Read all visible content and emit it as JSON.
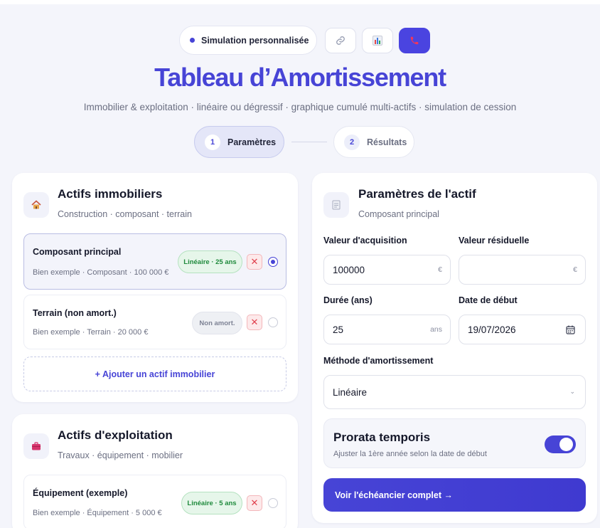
{
  "header": {
    "badge_label": "Simulation personnalisée",
    "title": "Tableau d’Amortissement",
    "subtitle": "Immobilier & exploitation · linéaire ou dégressif · graphique cumulé multi-actifs · simulation de cession",
    "icons": [
      "link-icon",
      "bar-chart-icon",
      "phone-icon"
    ]
  },
  "stepper": {
    "steps": [
      {
        "num": "1",
        "label": "Paramètres"
      },
      {
        "num": "2",
        "label": "Résultats"
      }
    ]
  },
  "real_estate": {
    "title": "Actifs immobiliers",
    "subtitle": "Construction · composant · terrain",
    "assets": [
      {
        "name": "Composant principal",
        "meta": "Bien exemple · Composant · 100 000 €",
        "tag": "Linéaire · 25 ans"
      },
      {
        "name": "Terrain (non amort.)",
        "meta": "Bien exemple · Terrain · 20 000 €",
        "tag": "Non amort."
      }
    ],
    "add_label": "+  Ajouter un actif immobilier"
  },
  "operating": {
    "title": "Actifs d'exploitation",
    "subtitle": "Travaux · équipement · mobilier",
    "assets": [
      {
        "name": "Équipement (exemple)",
        "meta": "Bien exemple · Équipement · 5 000 €",
        "tag": "Linéaire · 5 ans"
      }
    ]
  },
  "params": {
    "title": "Paramètres de l'actif",
    "subtitle": "Composant principal",
    "acq_label": "Valeur d'acquisition",
    "acq_value": "100000",
    "acq_unit": "€",
    "res_label": "Valeur résiduelle",
    "res_value": "",
    "res_unit": "€",
    "duration_label": "Durée (ans)",
    "duration_value": "25",
    "duration_unit": "ans",
    "start_label": "Date de début",
    "start_value": "19/07/2026",
    "method_label": "Méthode d'amortissement",
    "method_value": "Linéaire",
    "prorata_title": "Prorata temporis",
    "prorata_sub": "Ajuster la 1ère année selon la date de début",
    "prorata_on": true,
    "cta_label": "Voir l'échéancier complet →"
  },
  "colors": {
    "accent": "#4744d6",
    "tag_green": "#1f8a3c",
    "danger": "#e0414e"
  }
}
